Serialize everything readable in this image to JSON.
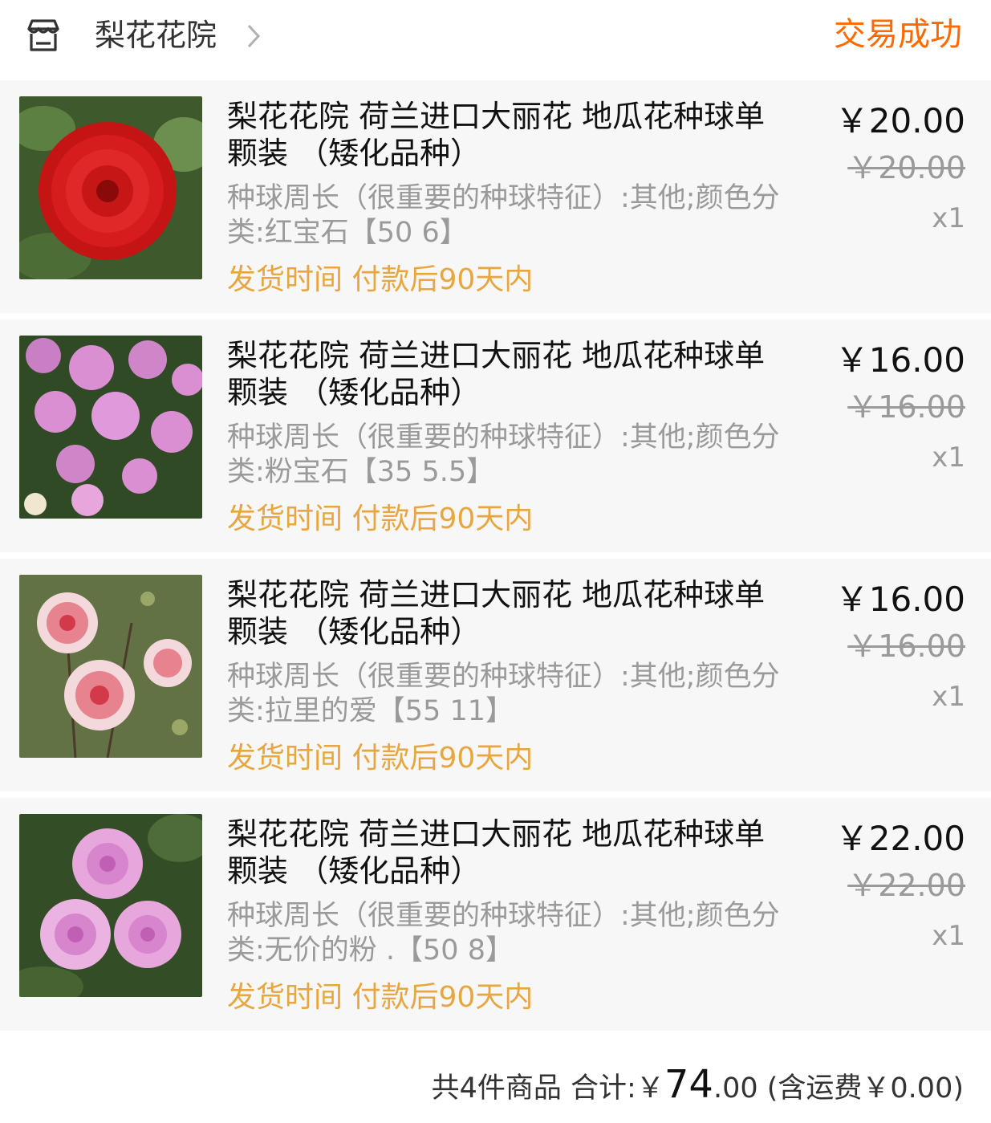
{
  "header": {
    "store_name": "梨花花院",
    "status": "交易成功"
  },
  "items": [
    {
      "title": "梨花花院 荷兰进口大丽花 地瓜花种球单颗装 （矮化品种）",
      "sku": "种球周长（很重要的种球特征）:其他;颜色分类:红宝石【50  6】",
      "shipping": "发货时间 付款后90天内",
      "price": "￥20.00",
      "original_price": "￥20.00",
      "quantity": "x1",
      "image_colors": {
        "bg": "#3e5a2c",
        "petal": "#d61c1c",
        "center": "#8a0a0a"
      }
    },
    {
      "title": "梨花花院 荷兰进口大丽花 地瓜花种球单颗装 （矮化品种）",
      "sku": "种球周长（很重要的种球特征）:其他;颜色分类:粉宝石【35  5.5】",
      "shipping": "发货时间 付款后90天内",
      "price": "￥16.00",
      "original_price": "￥16.00",
      "quantity": "x1",
      "image_colors": {
        "bg": "#2f4a25",
        "petal": "#d98fd2",
        "center": "#b866b0"
      }
    },
    {
      "title": "梨花花院 荷兰进口大丽花 地瓜花种球单颗装 （矮化品种）",
      "sku": "种球周长（很重要的种球特征）:其他;颜色分类:拉里的爱【55  11】",
      "shipping": "发货时间 付款后90天内",
      "price": "￥16.00",
      "original_price": "￥16.00",
      "quantity": "x1",
      "image_colors": {
        "bg": "#5b6b3f",
        "petal": "#f3d9dc",
        "center": "#d23a4a"
      }
    },
    {
      "title": "梨花花院 荷兰进口大丽花 地瓜花种球单颗装 （矮化品种）",
      "sku": "种球周长（很重要的种球特征）:其他;颜色分类:无价的粉 .【50  8】",
      "shipping": "发货时间 付款后90天内",
      "price": "￥22.00",
      "original_price": "￥22.00",
      "quantity": "x1",
      "image_colors": {
        "bg": "#334e26",
        "petal": "#e7a6dc",
        "center": "#c05fb4"
      }
    }
  ],
  "footer": {
    "count_text": "共4件商品",
    "total_label": "合计:",
    "currency": "￥",
    "total_int": "74",
    "total_dec": ".00",
    "shipping_note": "(含运费￥0.00)"
  },
  "icons": {
    "store": "store-icon",
    "chevron": "chevron-right-icon"
  },
  "colors": {
    "status": "#ff6a00",
    "shipping": "#e8a640",
    "muted": "#9a9a9a",
    "item_bg": "#f7f7f7"
  }
}
